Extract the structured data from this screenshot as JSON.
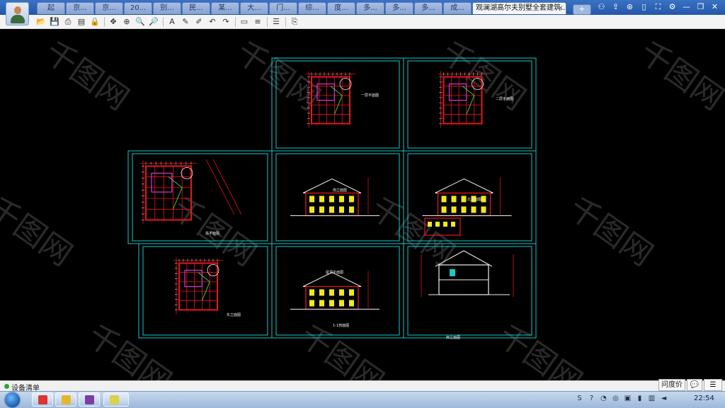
{
  "tabs": [
    {
      "label": "起"
    },
    {
      "label": "京..."
    },
    {
      "label": "京..."
    },
    {
      "label": "20..."
    },
    {
      "label": "别..."
    },
    {
      "label": "民..."
    },
    {
      "label": "某..."
    },
    {
      "label": "大..."
    },
    {
      "label": "门..."
    },
    {
      "label": "综..."
    },
    {
      "label": "度..."
    },
    {
      "label": "多..."
    },
    {
      "label": "多..."
    },
    {
      "label": "多..."
    },
    {
      "label": "成..."
    }
  ],
  "active_tab": {
    "label": "观澜湖高尔夫别墅全套建筑...",
    "close_glyph": "×"
  },
  "new_tab_glyph": "+",
  "title_controls": [
    {
      "name": "user-icon",
      "glyph": "⚇"
    },
    {
      "name": "share-icon",
      "glyph": "⇪"
    },
    {
      "name": "app-icon",
      "glyph": "⊛"
    },
    {
      "name": "mobile-icon",
      "glyph": "▯"
    },
    {
      "name": "fullscreen-icon",
      "glyph": "⛶"
    },
    {
      "name": "settings-icon",
      "glyph": "⚙"
    },
    {
      "name": "minimize-icon",
      "glyph": "—"
    },
    {
      "name": "restore-icon",
      "glyph": "❐"
    },
    {
      "name": "close-icon",
      "glyph": "✕"
    }
  ],
  "toolbar": [
    {
      "name": "open-icon",
      "glyph": "📂"
    },
    {
      "name": "save-icon",
      "glyph": "💾"
    },
    {
      "name": "print-icon",
      "glyph": "⎙"
    },
    {
      "name": "pdf-icon",
      "glyph": "▤"
    },
    {
      "name": "lock-icon",
      "glyph": "🔒"
    },
    {
      "sep": true
    },
    {
      "name": "pan-icon",
      "glyph": "✥"
    },
    {
      "name": "zoom-window-icon",
      "glyph": "⊕"
    },
    {
      "name": "zoom-in-icon",
      "glyph": "🔍"
    },
    {
      "name": "zoom-out-icon",
      "glyph": "🔎"
    },
    {
      "sep": true
    },
    {
      "name": "text-icon",
      "glyph": "A"
    },
    {
      "name": "pencil-icon",
      "glyph": "✎"
    },
    {
      "name": "highlight-icon",
      "glyph": "✐"
    },
    {
      "name": "undo-icon",
      "glyph": "↶"
    },
    {
      "name": "redo-icon",
      "glyph": "↷"
    },
    {
      "sep": true
    },
    {
      "name": "measure-icon",
      "glyph": "▭"
    },
    {
      "name": "mark-icon",
      "glyph": "≡"
    },
    {
      "sep": true
    },
    {
      "name": "layers-icon",
      "glyph": "☰"
    },
    {
      "sep": true
    },
    {
      "name": "export-icon",
      "glyph": "⎘"
    }
  ],
  "watermark": {
    "text": "千图网"
  },
  "sheet_labels": [
    {
      "text": "一层平面图"
    },
    {
      "text": "二层平面图"
    },
    {
      "text": "总平面图"
    },
    {
      "text": "南立面图"
    },
    {
      "text": "北立面图"
    },
    {
      "text": "东立面图"
    },
    {
      "text": "屋顶平面图"
    },
    {
      "text": "西立面图"
    },
    {
      "text": "1-1剖面图"
    }
  ],
  "colors": {
    "cad_cyan": "#19c8c8",
    "cad_red": "#e8151e",
    "cad_yellow": "#f3e81a",
    "cad_white": "#eeeeee"
  },
  "status_text": "设备清单",
  "ask_button": "问度价",
  "chat_button": "💬",
  "menu_button": "☰",
  "taskbar_apps": [
    {
      "name": "app-person"
    },
    {
      "name": "app-folder"
    },
    {
      "name": "app-winrar"
    },
    {
      "name": "app-viewer"
    }
  ],
  "tray_icons": [
    {
      "name": "sogou-icon",
      "glyph": "S"
    },
    {
      "name": "help-icon",
      "glyph": "?"
    },
    {
      "name": "lang-icon",
      "glyph": "◔"
    },
    {
      "name": "qq-icon",
      "glyph": "◎"
    },
    {
      "name": "monitor-icon",
      "glyph": "▣"
    },
    {
      "name": "battery-icon",
      "glyph": "▮"
    },
    {
      "name": "network-icon",
      "glyph": "▥"
    },
    {
      "name": "volume-icon",
      "glyph": "◄"
    }
  ],
  "clock": "22:54"
}
